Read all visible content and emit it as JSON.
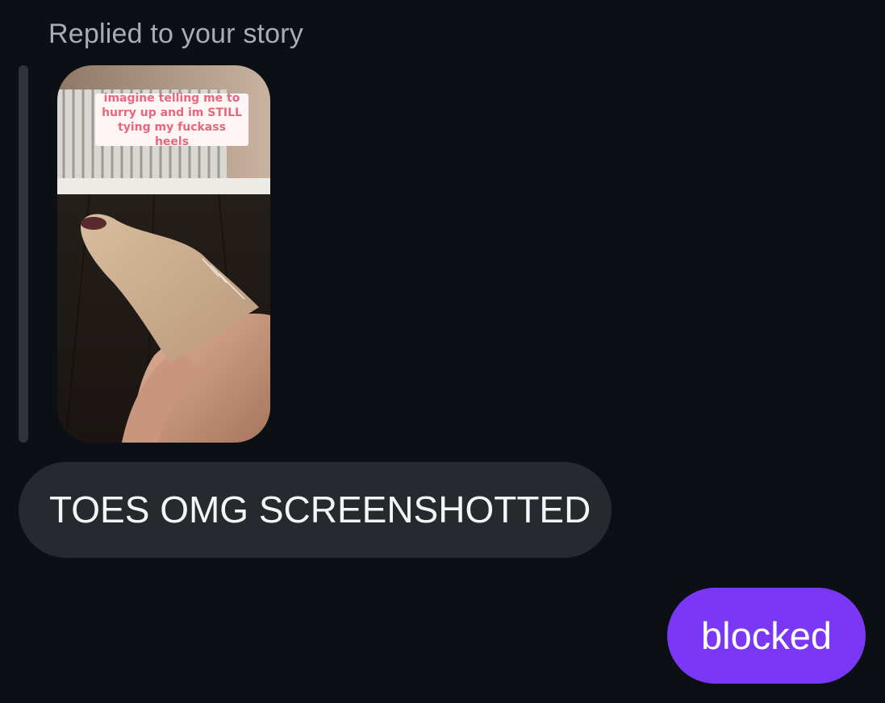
{
  "thread": {
    "story_caption": "Replied to your story",
    "story_sticker_text": "imagine telling me to hurry up and im STILL tying my fuckass heels",
    "messages": [
      {
        "direction": "received",
        "text": "TOES OMG SCREENSHOTTED"
      },
      {
        "direction": "sent",
        "text": "blocked"
      }
    ]
  },
  "colors": {
    "background": "#0c1014",
    "received_bubble": "#262a2f",
    "sent_bubble": "#7a37f5",
    "caption_text": "#a8adb5",
    "sticker_text": "#e8677c"
  }
}
